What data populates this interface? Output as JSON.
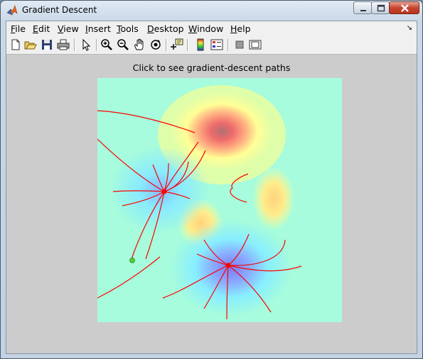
{
  "window": {
    "title": "Gradient Descent"
  },
  "menu": [
    {
      "accel": "F",
      "rest": "ile"
    },
    {
      "accel": "E",
      "rest": "dit"
    },
    {
      "accel": "V",
      "rest": "iew"
    },
    {
      "accel": "I",
      "rest": "nsert"
    },
    {
      "accel": "T",
      "rest": "ools"
    },
    {
      "accel": "D",
      "rest": "esktop"
    },
    {
      "accel": "W",
      "rest": "indow"
    },
    {
      "accel": "H",
      "rest": "elp"
    }
  ],
  "toolbar": {
    "icons": [
      "new-figure-icon",
      "open-file-icon",
      "save-icon",
      "print-icon",
      "pointer-icon",
      "zoom-in-icon",
      "zoom-out-icon",
      "pan-hand-icon",
      "rotate-3d-icon",
      "data-cursor-icon",
      "colorbar-icon",
      "legend-icon",
      "hide-plot-tools-icon",
      "show-plot-tools-icon"
    ]
  },
  "axes": {
    "title": "Click to see gradient-descent paths"
  },
  "colors": {
    "background": "#a6fcdc",
    "path": "#ff0000",
    "start_marker": "#55cc33",
    "minimum_marker": "#ff0000"
  }
}
